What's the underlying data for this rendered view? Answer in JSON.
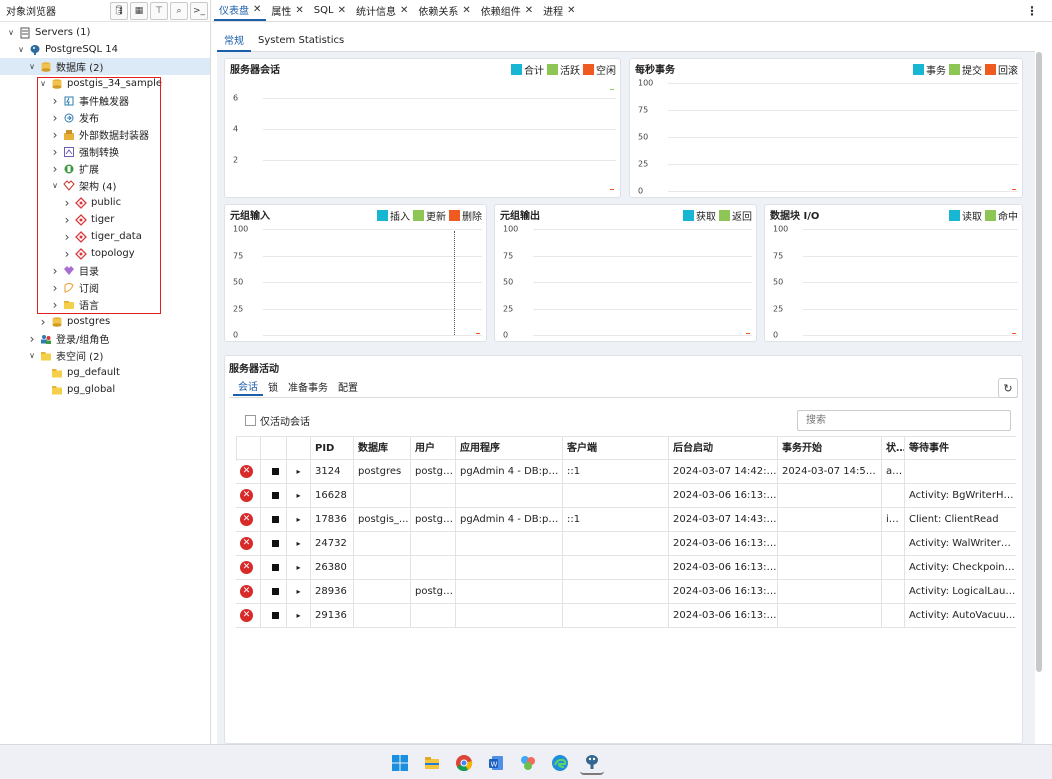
{
  "browser": {
    "title": "对象浏览器",
    "tree": [
      {
        "label": "Servers (1)",
        "depth": 0,
        "twisty": "v",
        "icon": "servers-icon"
      },
      {
        "label": "PostgreSQL 14",
        "depth": 1,
        "twisty": "v",
        "icon": "elephant-icon"
      },
      {
        "label": "数据库 (2)",
        "depth": 2,
        "twisty": "v",
        "icon": "database-icon",
        "selected": true
      },
      {
        "label": "postgis_34_sample",
        "depth": 3,
        "twisty": "v",
        "icon": "database-icon"
      },
      {
        "label": "事件触发器",
        "depth": 4,
        "twisty": ">",
        "icon": "event-trigger-icon"
      },
      {
        "label": "发布",
        "depth": 4,
        "twisty": ">",
        "icon": "publication-icon"
      },
      {
        "label": "外部数据封装器",
        "depth": 4,
        "twisty": ">",
        "icon": "fdw-icon"
      },
      {
        "label": "强制转换",
        "depth": 4,
        "twisty": ">",
        "icon": "cast-icon"
      },
      {
        "label": "扩展",
        "depth": 4,
        "twisty": ">",
        "icon": "extension-icon"
      },
      {
        "label": "架构 (4)",
        "depth": 4,
        "twisty": "v",
        "icon": "schema-icon"
      },
      {
        "label": "public",
        "depth": 5,
        "twisty": ">",
        "icon": "schema-item-icon"
      },
      {
        "label": "tiger",
        "depth": 5,
        "twisty": ">",
        "icon": "schema-item-icon"
      },
      {
        "label": "tiger_data",
        "depth": 5,
        "twisty": ">",
        "icon": "schema-item-icon"
      },
      {
        "label": "topology",
        "depth": 5,
        "twisty": ">",
        "icon": "schema-item-icon"
      },
      {
        "label": "目录",
        "depth": 4,
        "twisty": ">",
        "icon": "catalog-icon"
      },
      {
        "label": "订阅",
        "depth": 4,
        "twisty": ">",
        "icon": "subscription-icon"
      },
      {
        "label": "语言",
        "depth": 4,
        "twisty": ">",
        "icon": "language-icon"
      },
      {
        "label": "postgres",
        "depth": 3,
        "twisty": ">",
        "icon": "database-icon"
      },
      {
        "label": "登录/组角色",
        "depth": 2,
        "twisty": ">",
        "icon": "roles-icon"
      },
      {
        "label": "表空间 (2)",
        "depth": 2,
        "twisty": "v",
        "icon": "folder-icon"
      },
      {
        "label": "pg_default",
        "depth": 3,
        "twisty": "",
        "icon": "folder-icon"
      },
      {
        "label": "pg_global",
        "depth": 3,
        "twisty": "",
        "icon": "folder-icon"
      }
    ]
  },
  "tabs": [
    {
      "label": "仪表盘",
      "active": true
    },
    {
      "label": "属性"
    },
    {
      "label": "SQL"
    },
    {
      "label": "统计信息"
    },
    {
      "label": "依赖关系"
    },
    {
      "label": "依赖组件"
    },
    {
      "label": "进程"
    }
  ],
  "subtabs": [
    {
      "label": "常规",
      "active": true
    },
    {
      "label": "System Statistics"
    }
  ],
  "colors": {
    "teal": "#17b6d3",
    "green": "#8dc655",
    "orange": "#ee5a1f",
    "accent": "#1d5fa8"
  },
  "chart_data": [
    {
      "type": "line",
      "title": "服务器会话",
      "ylim": [
        0,
        7
      ],
      "yticks": [
        2,
        4,
        6
      ],
      "series": [
        {
          "name": "合计",
          "color": "teal"
        },
        {
          "name": "活跃",
          "color": "green"
        },
        {
          "name": "空闲",
          "color": "orange"
        }
      ]
    },
    {
      "type": "line",
      "title": "每秒事务",
      "ylim": [
        0,
        100
      ],
      "yticks": [
        0,
        25,
        50,
        75,
        100
      ],
      "series": [
        {
          "name": "事务",
          "color": "teal"
        },
        {
          "name": "提交",
          "color": "green"
        },
        {
          "name": "回滚",
          "color": "orange"
        }
      ]
    },
    {
      "type": "line",
      "title": "元组输入",
      "ylim": [
        0,
        100
      ],
      "yticks": [
        0,
        25,
        50,
        75,
        100
      ],
      "series": [
        {
          "name": "插入",
          "color": "teal"
        },
        {
          "name": "更新",
          "color": "green"
        },
        {
          "name": "删除",
          "color": "orange"
        }
      ]
    },
    {
      "type": "line",
      "title": "元组输出",
      "ylim": [
        0,
        100
      ],
      "yticks": [
        0,
        25,
        50,
        75,
        100
      ],
      "series": [
        {
          "name": "获取",
          "color": "teal"
        },
        {
          "name": "返回",
          "color": "green"
        }
      ]
    },
    {
      "type": "line",
      "title": "数据块 I/O",
      "ylim": [
        0,
        100
      ],
      "yticks": [
        0,
        25,
        50,
        75,
        100
      ],
      "series": [
        {
          "name": "读取",
          "color": "teal"
        },
        {
          "name": "命中",
          "color": "green"
        }
      ]
    }
  ],
  "activity": {
    "title": "服务器活动",
    "tabs": [
      {
        "label": "会话",
        "active": true
      },
      {
        "label": "锁"
      },
      {
        "label": "准备事务"
      },
      {
        "label": "配置"
      }
    ],
    "active_only_label": "仅活动会话",
    "search_placeholder": "搜索",
    "columns": [
      "PID",
      "数据库",
      "用户",
      "应用程序",
      "客户端",
      "后台启动",
      "事务开始",
      "状态",
      "等待事件"
    ],
    "rows": [
      [
        "3124",
        "postgres",
        "postgr...",
        "pgAdmin 4 - DB:post...",
        "::1",
        "2024-03-07 14:42:58...",
        "2024-03-07 14:54:01...",
        "act...",
        ""
      ],
      [
        "16628",
        "",
        "",
        "",
        "",
        "2024-03-06 16:13:03...",
        "",
        "",
        "Activity: BgWriterHib..."
      ],
      [
        "17836",
        "postgis_...",
        "postgr...",
        "pgAdmin 4 - DB:post...",
        "::1",
        "2024-03-07 14:43:09...",
        "",
        "idle",
        "Client: ClientRead"
      ],
      [
        "24732",
        "",
        "",
        "",
        "",
        "2024-03-06 16:13:03...",
        "",
        "",
        "Activity: WalWriterM..."
      ],
      [
        "26380",
        "",
        "",
        "",
        "",
        "2024-03-06 16:13:03...",
        "",
        "",
        "Activity: Checkpoint..."
      ],
      [
        "28936",
        "",
        "postgr...",
        "",
        "",
        "2024-03-06 16:13:03...",
        "",
        "",
        "Activity: LogicalLaun..."
      ],
      [
        "29136",
        "",
        "",
        "",
        "",
        "2024-03-06 16:13:03...",
        "",
        "",
        "Activity: AutoVacuu..."
      ]
    ]
  },
  "taskbar": [
    "windows-start-icon",
    "file-explorer-icon",
    "chrome-icon",
    "word-icon",
    "colorful-app-icon",
    "edge-icon",
    "pgadmin-icon"
  ]
}
